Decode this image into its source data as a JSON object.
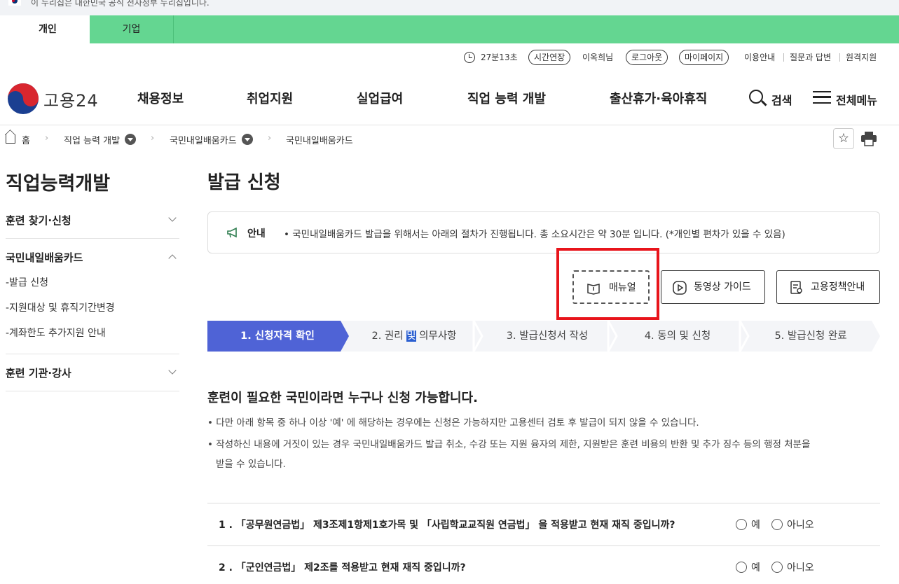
{
  "gov_banner": {
    "text": "이 누리집은 대한민국 공식 전자정부 누리집입니다."
  },
  "user_tabs": [
    {
      "label": "개인"
    },
    {
      "label": "기업"
    }
  ],
  "utility": {
    "timer": "27분13초",
    "extend": "시간연장",
    "user": "이옥희님",
    "logout": "로그아웃",
    "mypage": "마이페이지",
    "links": [
      "이용안내",
      "질문과 답변",
      "원격지원"
    ]
  },
  "header": {
    "logo_text": "고용24",
    "nav": [
      "채용정보",
      "취업지원",
      "실업급여",
      "직업 능력 개발",
      "출산휴가·육아휴직"
    ],
    "search_label": "검색",
    "menu_label": "전체메뉴"
  },
  "breadcrumb": [
    "홈",
    "직업 능력 개발",
    "국민내일배움카드",
    "국민내일배움카드"
  ],
  "sidebar": {
    "title": "직업능력개발",
    "sections": [
      {
        "label": "훈련 찾기·신청"
      },
      {
        "label": "국민내일배움카드",
        "items": [
          "-발급 신청",
          "-지원대상 및 휴직기간변경",
          "-계좌한도 추가지원 안내"
        ]
      },
      {
        "label": "훈련 기관·강사"
      }
    ]
  },
  "main": {
    "title": "발급 신청",
    "notice": {
      "label": "안내",
      "text": "• 국민내일배움카드 발급을 위해서는 아래의 절차가 진행됩니다. 총 소요시간은 약 30분 입니다. (*개인별 편차가 있을 수 있음)"
    },
    "buttons": [
      "매뉴얼",
      "동영상 가이드",
      "고용정책안내"
    ],
    "steps": [
      {
        "label": "1. 신청자격 확인",
        "active": true
      },
      {
        "label": "2. 권리",
        "sel": "및",
        "rest": "의무사항"
      },
      {
        "label": "3. 발급신청서 작성"
      },
      {
        "label": "4. 동의 및 신청"
      },
      {
        "label": "5. 발급신청 완료"
      }
    ],
    "heading": "훈련이 필요한 국민이라면 누구나 신청 가능합니다.",
    "bullets": [
      "• 다만 아래 항목 중 하나 이상 '예' 에 해당하는 경우에는 신청은 가능하지만 고용센터 검토 후 발급이 되지 않을 수 있습니다.",
      "• 작성하신 내용에 거짓이 있는 경우 국민내일배움카드 발급 취소, 수강 또는 지원 융자의 제한, 지원받은 훈련 비용의 반환 및 추가 징수 등의 행정 처분을",
      "받을 수 있습니다."
    ],
    "questions": [
      {
        "text": "1 . 「공무원연금법」 제3조제1항제1호가목 및 「사립학교교직원 연금법」 을 적용받고 현재 재직 중입니까?",
        "yes": "예",
        "no": "아니오"
      },
      {
        "text": "2 . 「군인연금법」 제2조를 적용받고 현재 재직 중입니까?",
        "yes": "예",
        "no": "아니오"
      }
    ]
  },
  "colors": {
    "green": "#64d691",
    "step_active": "#4f63d6",
    "highlight": "#e8141b"
  }
}
